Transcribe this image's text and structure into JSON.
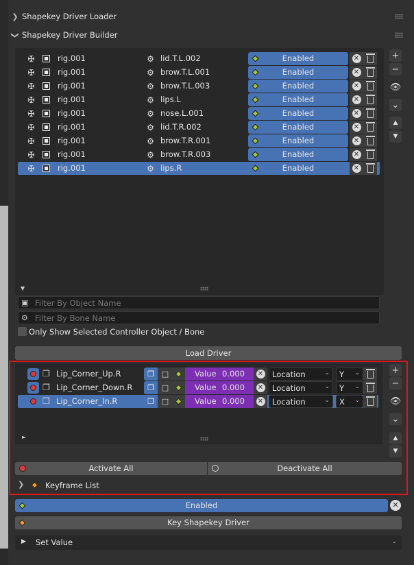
{
  "panels": {
    "loader_label": "Shapekey Driver Loader",
    "builder_label": "Shapekey Driver Builder"
  },
  "driver_list": [
    {
      "object": "rig.001",
      "bone": "lid.T.L.002",
      "status": "Enabled",
      "selected": false
    },
    {
      "object": "rig.001",
      "bone": "brow.T.L.001",
      "status": "Enabled",
      "selected": false
    },
    {
      "object": "rig.001",
      "bone": "brow.T.L.003",
      "status": "Enabled",
      "selected": false
    },
    {
      "object": "rig.001",
      "bone": "lips.L",
      "status": "Enabled",
      "selected": false
    },
    {
      "object": "rig.001",
      "bone": "nose.L.001",
      "status": "Enabled",
      "selected": false
    },
    {
      "object": "rig.001",
      "bone": "lid.T.R.002",
      "status": "Enabled",
      "selected": false
    },
    {
      "object": "rig.001",
      "bone": "brow.T.R.001",
      "status": "Enabled",
      "selected": false
    },
    {
      "object": "rig.001",
      "bone": "brow.T.R.003",
      "status": "Enabled",
      "selected": false
    },
    {
      "object": "rig.001",
      "bone": "lips.R",
      "status": "Enabled",
      "selected": true
    }
  ],
  "filters": {
    "object_placeholder": "Filter By Object Name",
    "bone_placeholder": "Filter By Bone Name",
    "only_selected_label": "Only Show Selected Controller Object / Bone"
  },
  "load_driver_label": "Load Driver",
  "shapekey_list": [
    {
      "name": "Lip_Corner_Up.R",
      "value_label": "Value",
      "value": "0.000",
      "transform": "Location",
      "axis": "Y",
      "selected": false
    },
    {
      "name": "Lip_Corner_Down.R",
      "value_label": "Value",
      "value": "0.000",
      "transform": "Location",
      "axis": "Y",
      "selected": false
    },
    {
      "name": "Lip_Corner_In.R",
      "value_label": "Value",
      "value": "0.000",
      "transform": "Location",
      "axis": "X",
      "selected": true
    }
  ],
  "activate_all_label": "Activate All",
  "deactivate_all_label": "Deactivate All",
  "keyframe_list_label": "Keyframe List",
  "enabled_label": "Enabled",
  "key_shapekey_label": "Key Shapekey Driver",
  "set_value_label": "Set Value",
  "colors": {
    "accent": "#4772b3",
    "value_field": "#7d2fb3",
    "highlight_border": "#e0151a"
  }
}
